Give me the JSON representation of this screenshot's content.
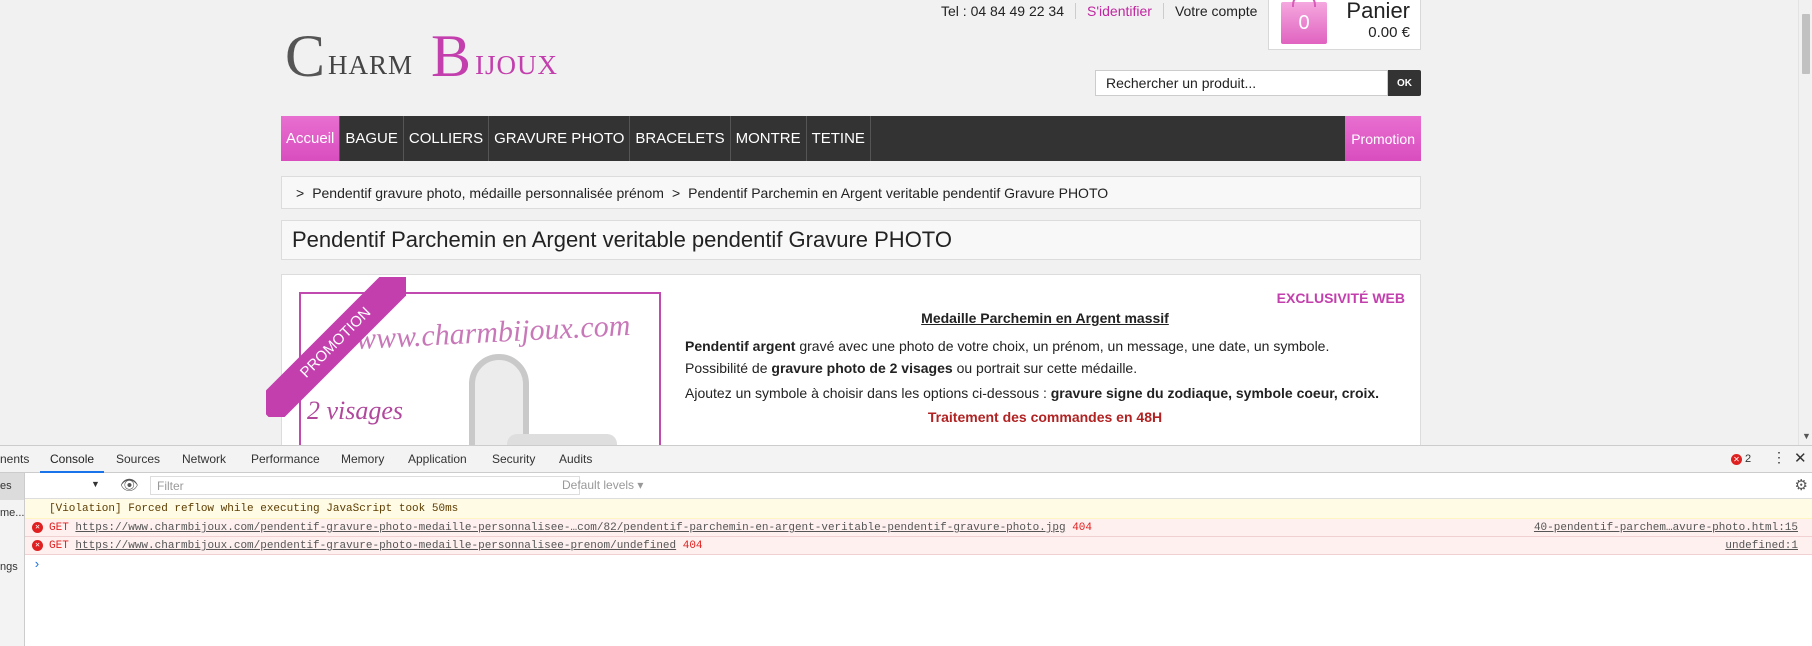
{
  "site": {
    "logo": {
      "c": "C",
      "harm": "HARM",
      "b": "B",
      "ijoux": "IJOUX"
    },
    "topbar": {
      "tel": "Tel : 04 84 49 22 34",
      "login": "S'identifier",
      "account": "Votre compte"
    },
    "cart": {
      "count": "0",
      "title": "Panier",
      "total": "0.00 €"
    },
    "search": {
      "placeholder": "Rechercher un produit...",
      "button": "OK"
    },
    "nav": {
      "items": [
        "Accueil",
        "BAGUE",
        "COLLIERS",
        "GRAVURE PHOTO",
        "BRACELETS",
        "MONTRE",
        "TETINE"
      ],
      "promo": "Promotion"
    },
    "breadcrumb": {
      "sep": ">",
      "cat": "Pendentif gravure photo, médaille personnalisée prénom",
      "sep2": ">",
      "current": "Pendentif Parchemin en Argent veritable pendentif Gravure PHOTO"
    },
    "title": "Pendentif Parchemin en Argent veritable pendentif Gravure PHOTO",
    "product": {
      "ribbon": "PROMOTION",
      "watermark": "www.charmbijoux.com",
      "photo_text": "2 visages",
      "exclusive": "EXCLUSIVITÉ WEB",
      "heading": "Medaille Parchemin en Argent massif ",
      "l1_bold": "Pendentif argent",
      "l1_rest": " gravé avec une photo de votre choix, un prénom, un message, une date, un symbole.",
      "l2_a": "Possibilité de ",
      "l2_bold": "gravure photo de 2 visages",
      "l2_rest": " ou portrait sur cette médaille.",
      "l3_a": "Ajoutez un symbole à choisir dans les options ci-dessous : ",
      "l3_bold": "gravure signe du zodiaque, symbole coeur, croix.",
      "red": "Traitement des commandes en 48H"
    }
  },
  "devtools": {
    "tabs": [
      "nents",
      "Console",
      "Sources",
      "Network",
      "Performance",
      "Memory",
      "Application",
      "Security",
      "Audits"
    ],
    "error_count": "2",
    "sidebar": [
      "es",
      "me...",
      "",
      "ngs"
    ],
    "filter_placeholder": "Filter",
    "levels": "Default levels ▾",
    "messages": [
      {
        "type": "violation",
        "text": "[Violation] Forced reflow while executing JavaScript took 50ms"
      },
      {
        "type": "error",
        "method": "GET",
        "url": "https://www.charmbijoux.com/pendentif-gravure-photo-medaille-personnalisee-…com/82/pendentif-parchemin-en-argent-veritable-pendentif-gravure-photo.jpg",
        "code": "404",
        "source": "40-pendentif-parchem…avure-photo.html:15"
      },
      {
        "type": "error",
        "method": "GET",
        "url": "https://www.charmbijoux.com/pendentif-gravure-photo-medaille-personnalisee-prenom/undefined",
        "code": "404",
        "source": "undefined:1"
      }
    ],
    "prompt": "›"
  }
}
